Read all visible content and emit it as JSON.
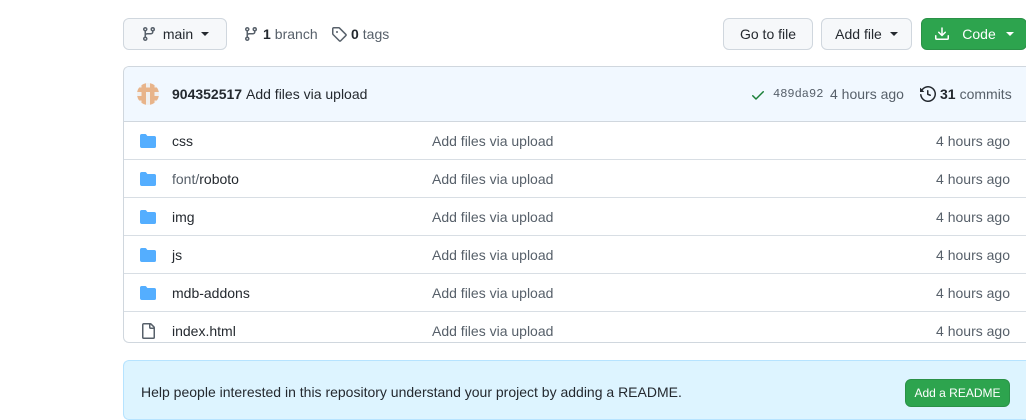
{
  "toolbar": {
    "branch_label": "main",
    "branches_count": "1",
    "branches_label": "branch",
    "tags_count": "0",
    "tags_label": "tags",
    "goto_file_label": "Go to file",
    "add_file_label": "Add file",
    "code_label": "Code"
  },
  "commit": {
    "user": "904352517",
    "message": "Add files via upload",
    "sha": "489da92",
    "time": "4 hours ago",
    "commits_count": "31",
    "commits_label": "commits"
  },
  "files": [
    {
      "type": "folder",
      "name_prefix": "",
      "name": "css",
      "message": "Add files via upload",
      "time": "4 hours ago"
    },
    {
      "type": "folder",
      "name_prefix": "font/",
      "name": "roboto",
      "message": "Add files via upload",
      "time": "4 hours ago"
    },
    {
      "type": "folder",
      "name_prefix": "",
      "name": "img",
      "message": "Add files via upload",
      "time": "4 hours ago"
    },
    {
      "type": "folder",
      "name_prefix": "",
      "name": "js",
      "message": "Add files via upload",
      "time": "4 hours ago"
    },
    {
      "type": "folder",
      "name_prefix": "",
      "name": "mdb-addons",
      "message": "Add files via upload",
      "time": "4 hours ago"
    },
    {
      "type": "file",
      "name_prefix": "",
      "name": "index.html",
      "message": "Add files via upload",
      "time": "4 hours ago"
    }
  ],
  "readme": {
    "text": "Help people interested in this repository understand your project by adding a README.",
    "button_label": "Add a README"
  },
  "colors": {
    "primary_green": "#2da44e",
    "folder_blue": "#54aeff",
    "header_bg": "#f1f8ff",
    "readme_bg": "#ddf4ff"
  },
  "icons": {
    "branch": "git-branch-icon",
    "tag": "tag-icon",
    "download": "download-icon",
    "check": "check-icon",
    "history": "history-icon",
    "folder": "folder-icon",
    "file": "file-icon"
  }
}
